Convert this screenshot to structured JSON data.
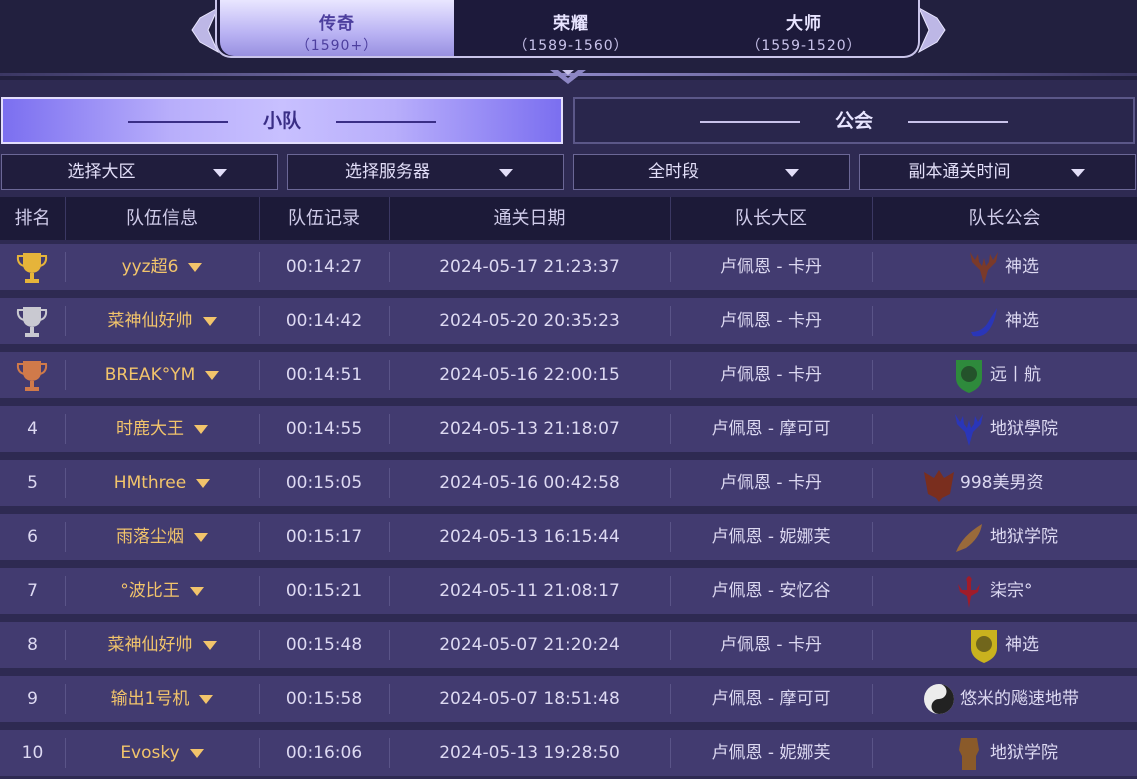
{
  "tiers": [
    {
      "name": "传奇",
      "range": "（1590+）",
      "active": true
    },
    {
      "name": "荣耀",
      "range": "（1589-1560）",
      "active": false
    },
    {
      "name": "大师",
      "range": "（1559-1520）",
      "active": false
    }
  ],
  "subtabs": {
    "team": "小队",
    "guild": "公会"
  },
  "filters": {
    "region": "选择大区",
    "server": "选择服务器",
    "period": "全时段",
    "sort": "副本通关时间"
  },
  "columns": {
    "rank": "排名",
    "team": "队伍信息",
    "record": "队伍记录",
    "date": "通关日期",
    "region": "队长大区",
    "guild": "队长公会"
  },
  "rows": [
    {
      "rank": "",
      "trophy": "gold-trophy-icon",
      "team": "yyz超6",
      "record": "00:14:27",
      "date": "2024-05-17 21:23:37",
      "region": "卢佩恩 - 卡丹",
      "guild": "神选",
      "guild_icon": "antlers-icon",
      "icon_color": "#7a3a2a"
    },
    {
      "rank": "",
      "trophy": "silver-trophy-icon",
      "team": "菜神仙好帅",
      "record": "00:14:42",
      "date": "2024-05-20 20:35:23",
      "region": "卢佩恩 - 卡丹",
      "guild": "神选",
      "guild_icon": "wing-icon",
      "icon_color": "#2a36b8"
    },
    {
      "rank": "",
      "trophy": "bronze-trophy-icon",
      "team": "BREAK°YM",
      "record": "00:14:51",
      "date": "2024-05-16 22:00:15",
      "region": "卢佩恩 - 卡丹",
      "guild": "远丨航",
      "guild_icon": "lion-shield-icon",
      "icon_color": "#2e8a3c"
    },
    {
      "rank": "4",
      "team": "时鹿大王",
      "record": "00:14:55",
      "date": "2024-05-13 21:18:07",
      "region": "卢佩恩 - 摩可可",
      "guild": "地狱學院",
      "guild_icon": "antlers-icon",
      "icon_color": "#2a36b8"
    },
    {
      "rank": "5",
      "team": "HMthree",
      "record": "00:15:05",
      "date": "2024-05-16 00:42:58",
      "region": "卢佩恩 - 卡丹",
      "guild": "998美男资",
      "guild_icon": "demon-wings-icon",
      "icon_color": "#7a2e1e"
    },
    {
      "rank": "6",
      "team": "雨落尘烟",
      "record": "00:15:17",
      "date": "2024-05-13 16:15:44",
      "region": "卢佩恩 - 妮娜芙",
      "guild": "地狱学院",
      "guild_icon": "feather-icon",
      "icon_color": "#9a6a3a"
    },
    {
      "rank": "7",
      "team": "°波比王",
      "record": "00:15:21",
      "date": "2024-05-11 21:08:17",
      "region": "卢佩恩 - 安忆谷",
      "guild": "柒宗°",
      "guild_icon": "scorpion-icon",
      "icon_color": "#a01c2a"
    },
    {
      "rank": "8",
      "team": "菜神仙好帅",
      "record": "00:15:48",
      "date": "2024-05-07 21:20:24",
      "region": "卢佩恩 - 卡丹",
      "guild": "神选",
      "guild_icon": "lion-shield-icon",
      "icon_color": "#c9b21e"
    },
    {
      "rank": "9",
      "team": "输出1号机",
      "record": "00:15:58",
      "date": "2024-05-07 18:51:48",
      "region": "卢佩恩 - 摩可可",
      "guild": "悠米的飚速地带",
      "guild_icon": "yin-yang-icon",
      "icon_color": "#222222"
    },
    {
      "rank": "10",
      "team": "Evosky",
      "record": "00:16:06",
      "date": "2024-05-13 19:28:50",
      "region": "卢佩恩 - 妮娜芙",
      "guild": "地狱学院",
      "guild_icon": "fist-icon",
      "icon_color": "#8a5a2a"
    }
  ]
}
